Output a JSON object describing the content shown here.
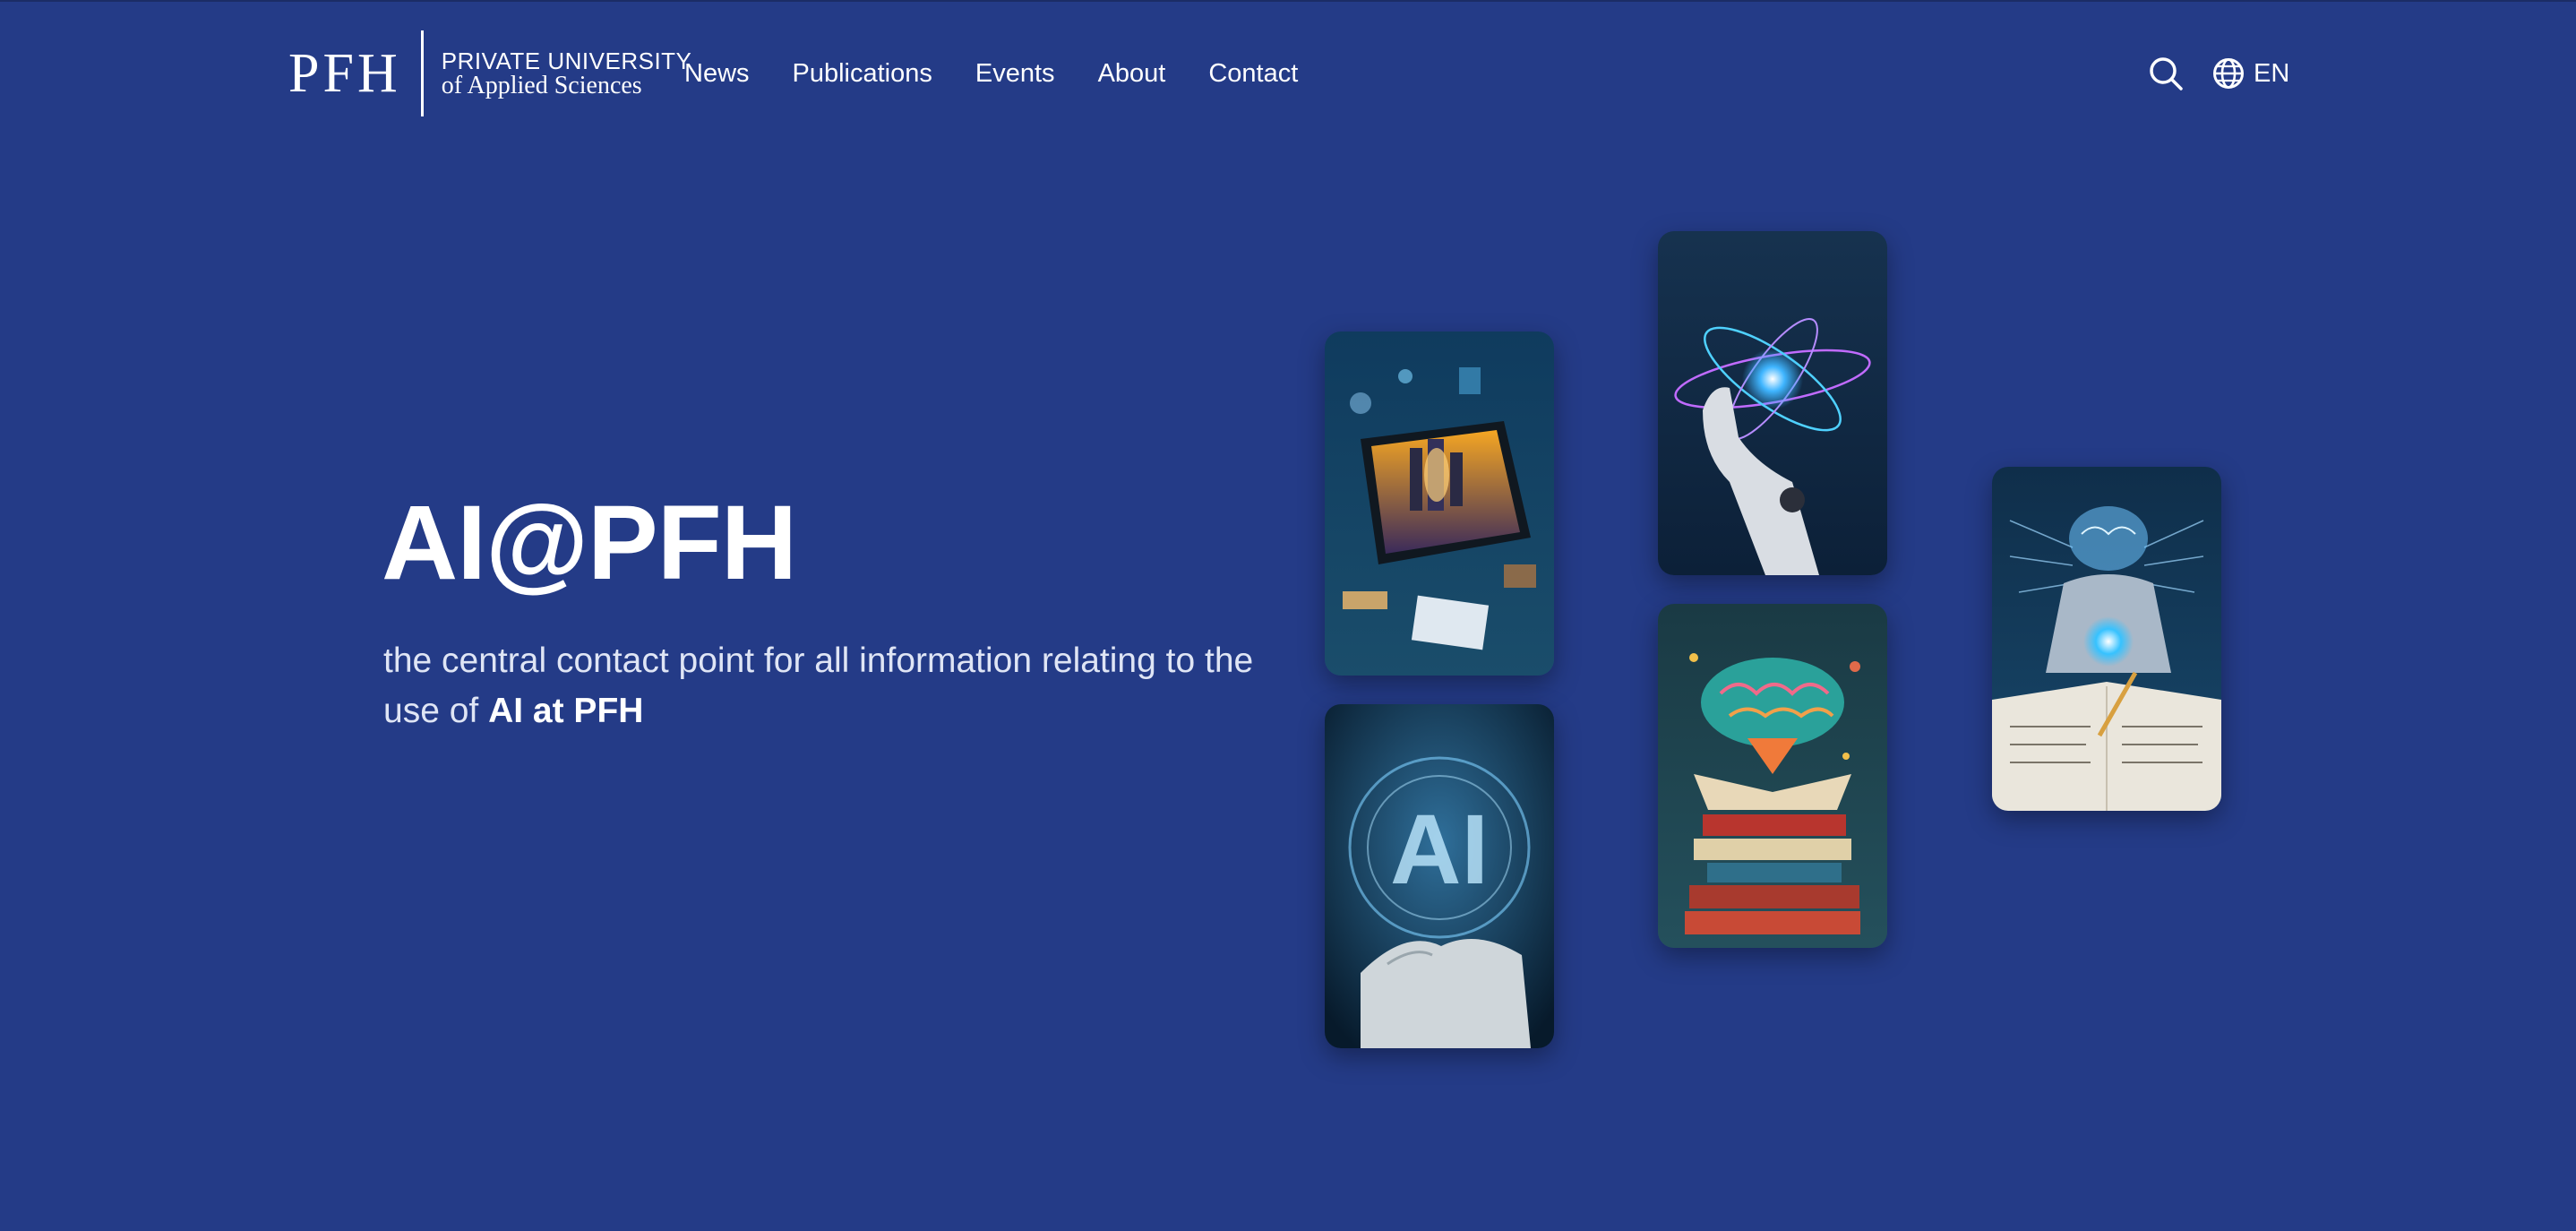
{
  "header": {
    "logo": {
      "mark": "PFH",
      "line1": "PRIVATE UNIVERSITY",
      "line2": "of Applied Sciences"
    },
    "nav": [
      {
        "label": "News"
      },
      {
        "label": "Publications"
      },
      {
        "label": "Events"
      },
      {
        "label": "About"
      },
      {
        "label": "Contact"
      }
    ],
    "search_icon": "search-icon",
    "language": {
      "icon": "globe-icon",
      "label": "EN"
    }
  },
  "hero": {
    "title": "AI@PFH",
    "subtitle_text": "the central contact point for all information relating to the use of ",
    "subtitle_bold": "AI at PFH"
  },
  "colors": {
    "background": "#243b87",
    "text": "#ffffff"
  },
  "images": [
    {
      "name": "card-ai-city-tablet"
    },
    {
      "name": "card-ai-hand-hologram"
    },
    {
      "name": "card-robot-hand-atom"
    },
    {
      "name": "card-brain-books"
    },
    {
      "name": "card-robot-studying"
    }
  ]
}
